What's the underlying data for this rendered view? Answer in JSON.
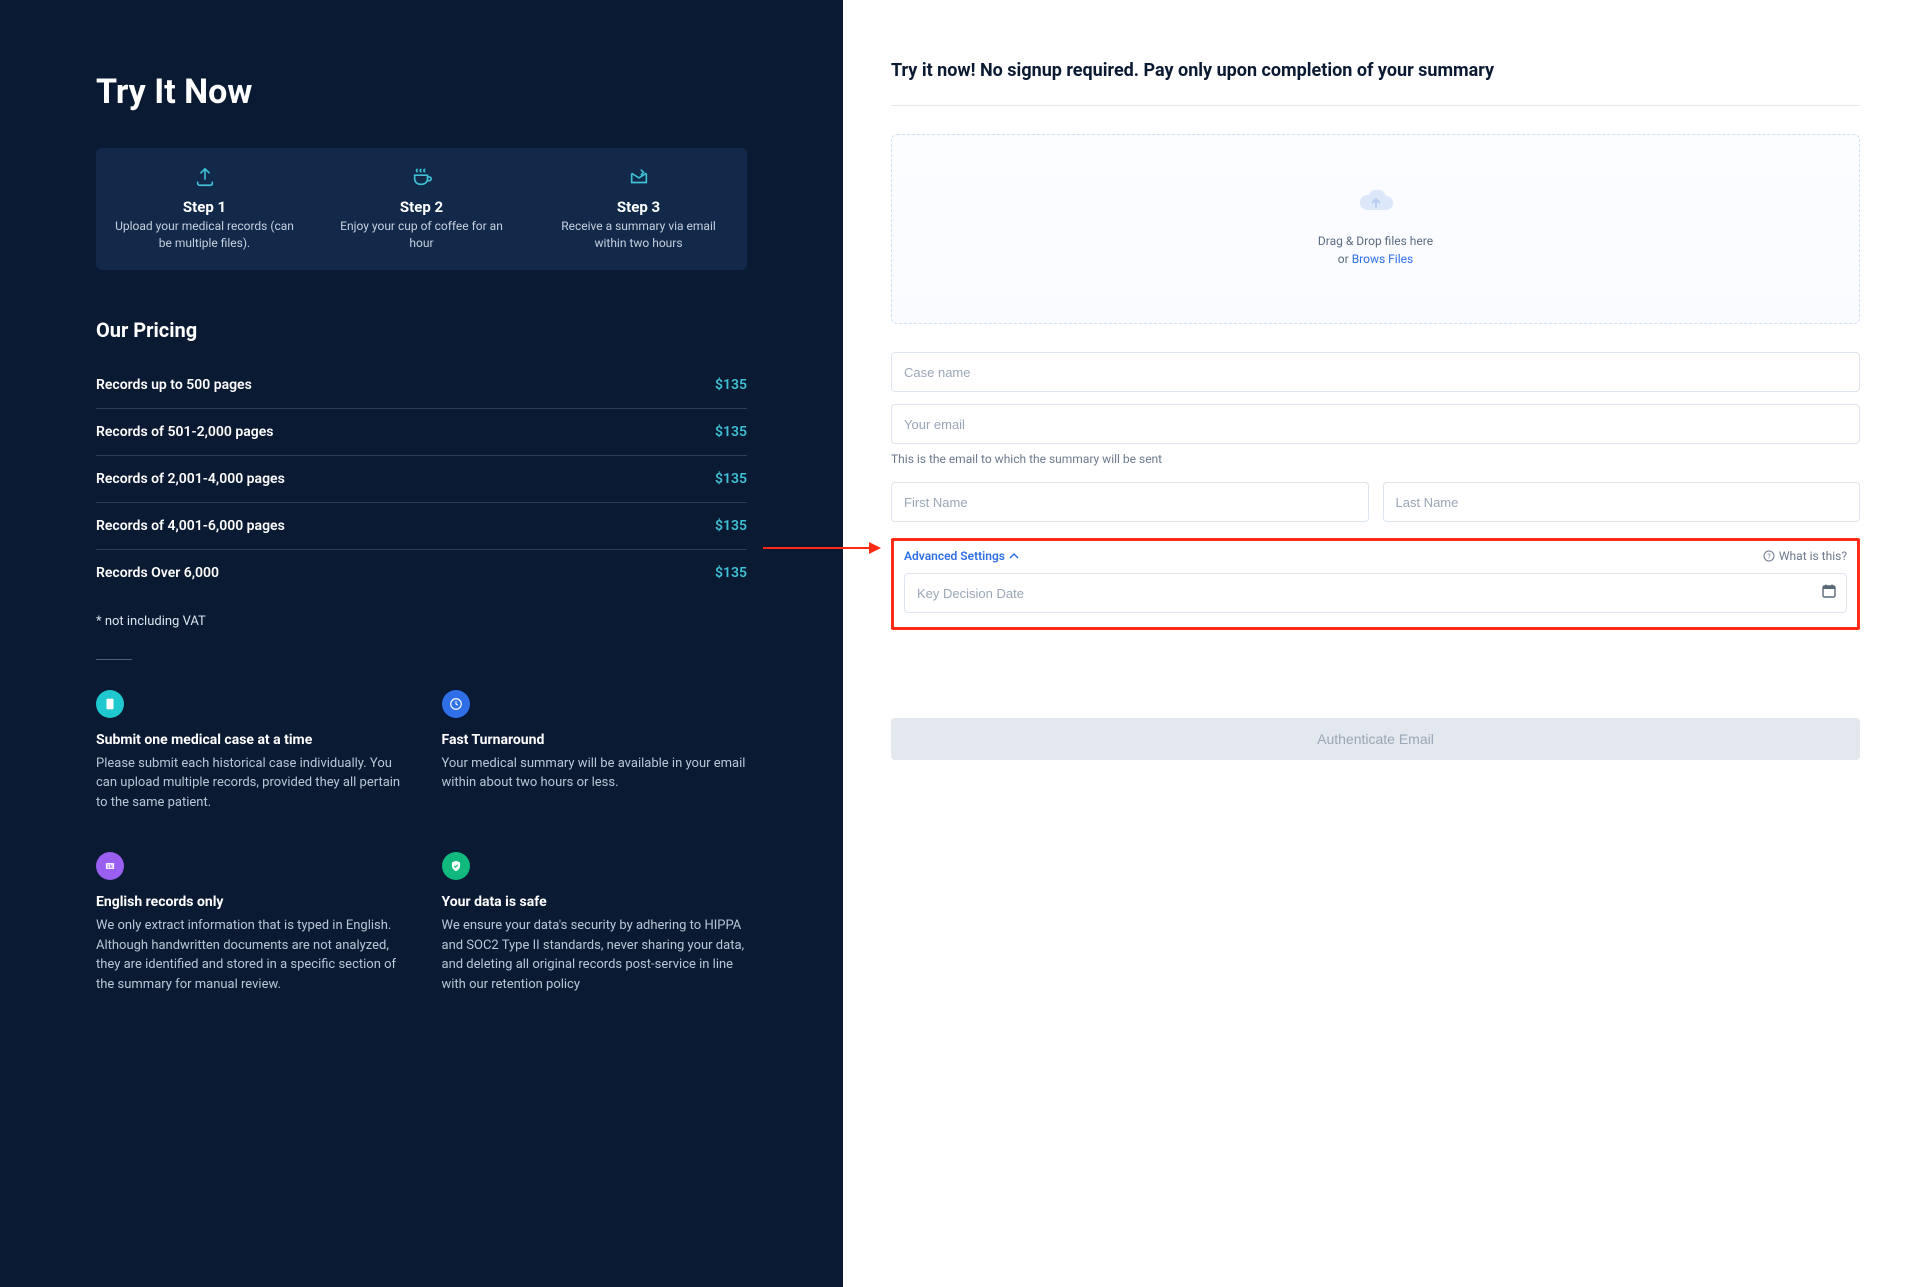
{
  "left": {
    "title": "Try It Now",
    "steps": [
      {
        "title": "Step 1",
        "desc": "Upload your medical records (can be multiple files)."
      },
      {
        "title": "Step 2",
        "desc": "Enjoy your cup of coffee for an hour"
      },
      {
        "title": "Step 3",
        "desc": "Receive a  summary via email within two hours"
      }
    ],
    "pricing_title": "Our Pricing",
    "pricing": [
      {
        "label": "Records up to 500 pages",
        "value": "$135"
      },
      {
        "label": "Records of 501-2,000 pages",
        "value": "$135"
      },
      {
        "label": "Records of 2,001-4,000 pages",
        "value": "$135"
      },
      {
        "label": "Records of 4,001-6,000 pages",
        "value": "$135"
      },
      {
        "label": "Records Over 6,000",
        "value": "$135"
      }
    ],
    "vat_note": "* not including VAT",
    "features": [
      {
        "title": "Submit one medical case at a time",
        "desc": "Please submit each historical case individually. You can upload multiple records, provided they all pertain to the same patient.",
        "color": "#1fc8ce"
      },
      {
        "title": "Fast Turnaround",
        "desc": "Your medical summary will be available in your email within about two hours or less.",
        "color": "#2f6fe8"
      },
      {
        "title": "English records only",
        "desc": "We only extract information that is typed in English. Although handwritten documents are not analyzed, they are identified and stored in a specific section of the summary for manual review.",
        "color": "#9a5ff1"
      },
      {
        "title": "Your data is safe",
        "desc": "We ensure your data's security by adhering to HIPPA and SOC2 Type II standards, never sharing your data, and deleting all original records post-service in line with our retention policy",
        "color": "#11b97e"
      }
    ]
  },
  "right": {
    "heading": "Try it now! No signup required. Pay only upon completion of your summary",
    "dropzone_line1": "Drag & Drop files here",
    "dropzone_or": "or ",
    "dropzone_link": "Brows Files",
    "case_name_placeholder": "Case name",
    "email_placeholder": "Your email",
    "email_hint": "This is the email to which the summary will be sent",
    "first_name_placeholder": "First Name",
    "last_name_placeholder": "Last Name",
    "advanced_label": "Advanced Settings",
    "what_is_this": "What is this?",
    "key_date_placeholder": "Key Decision Date",
    "auth_button": "Authenticate Email"
  }
}
